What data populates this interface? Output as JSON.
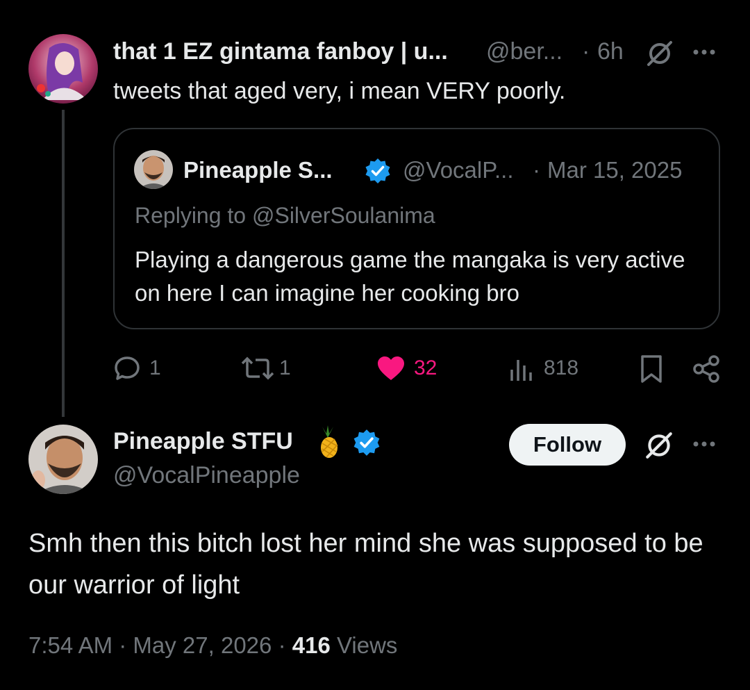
{
  "tweet1": {
    "display_name": "that 1 EZ gintama fanboy | u...",
    "handle": "@ber...",
    "separator": "·",
    "time": "6h",
    "text": "tweets that aged very, i mean VERY poorly.",
    "quote": {
      "display_name": "Pineapple S...",
      "handle": "@VocalP...",
      "separator": "·",
      "date": "Mar 15, 2025",
      "replying_to": "Replying to @SilverSoulanima",
      "text": "Playing a dangerous game the mangaka is very active on here I can imagine her cooking bro"
    },
    "actions": {
      "replies": "1",
      "reposts": "1",
      "likes": "32",
      "views": "818"
    }
  },
  "tweet2": {
    "display_name": "Pineapple STFU",
    "handle": "@VocalPineapple",
    "follow_label": "Follow",
    "text": "Smh then this bitch lost her mind she was supposed to be our warrior of light",
    "time": "7:54 AM",
    "sep1": "·",
    "date": "May 27, 2026",
    "sep2": "·",
    "views_count": "416",
    "views_label": "Views"
  },
  "icons": {
    "verified": "verified-badge-icon",
    "grok": "grok-icon",
    "more": "more-icon",
    "reply": "reply-icon",
    "repost": "repost-icon",
    "like": "heart-icon",
    "views": "views-icon",
    "bookmark": "bookmark-icon",
    "share": "share-icon",
    "pineapple": "pineapple-emoji-icon"
  },
  "colors": {
    "background": "#000000",
    "text": "#e7e9ea",
    "muted": "#71767b",
    "verified": "#1d9bf0",
    "like": "#f91880",
    "border": "#2f3336"
  }
}
